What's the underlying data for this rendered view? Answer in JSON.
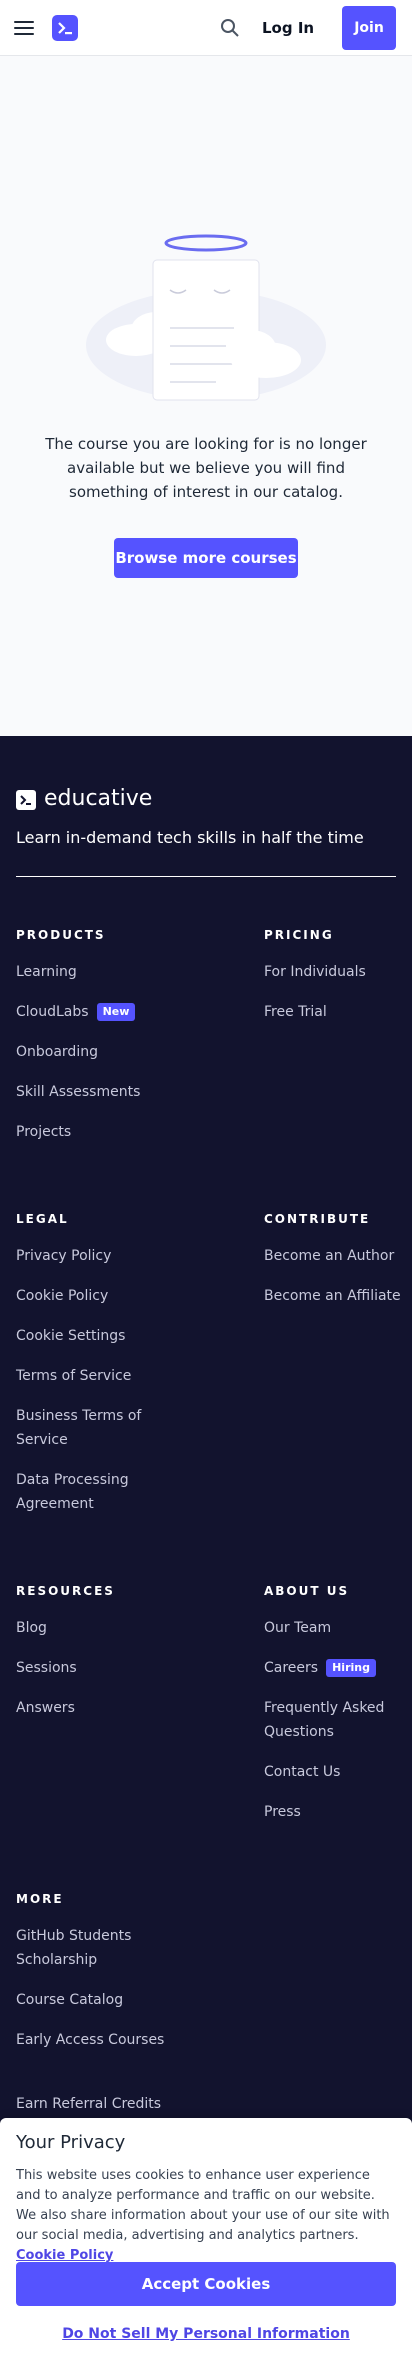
{
  "header": {
    "login_label": "Log In",
    "join_label": "Join"
  },
  "empty_state": {
    "message": "The course you are looking for is no longer available but we believe you will find something of interest in our catalog.",
    "button_label": "Browse more courses"
  },
  "footer": {
    "brand": "educative",
    "tagline": "Learn in-demand tech skills in half the time",
    "products": {
      "title": "PRODUCTS",
      "items": [
        "Learning",
        "CloudLabs",
        "Onboarding",
        "Skill Assessments",
        "Projects"
      ],
      "cloudlabs_badge": "New"
    },
    "pricing": {
      "title": "PRICING",
      "items": [
        "For Individuals",
        "Free Trial"
      ]
    },
    "legal": {
      "title": "LEGAL",
      "items": [
        "Privacy Policy",
        "Cookie Policy",
        "Cookie Settings",
        "Terms of Service",
        "Business Terms of Service",
        "Data Processing Agreement"
      ]
    },
    "contribute": {
      "title": "CONTRIBUTE",
      "items": [
        "Become an Author",
        "Become an Affiliate"
      ]
    },
    "resources": {
      "title": "RESOURCES",
      "items": [
        "Blog",
        "Sessions",
        "Answers"
      ]
    },
    "about": {
      "title": "ABOUT US",
      "items": [
        "Our Team",
        "Careers",
        "Frequently Asked Questions",
        "Contact Us",
        "Press"
      ],
      "careers_badge": "Hiring"
    },
    "more": {
      "title": "MORE",
      "items": [
        "GitHub Students Scholarship",
        "Course Catalog",
        "Early Access Courses",
        "Earn Referral Credits"
      ]
    }
  },
  "privacy": {
    "title": "Your Privacy",
    "text": "This website uses cookies to enhance user experience and to analyze performance and traffic on our website. We also share information about your use of our site with our social media, advertising and analytics partners.",
    "policy_link": "Cookie Policy",
    "accept_label": "Accept Cookies",
    "dnsmpi_label": "Do Not Sell My Personal Information"
  },
  "colors": {
    "brand": "#5553ff",
    "footer_bg": "#12132e"
  }
}
